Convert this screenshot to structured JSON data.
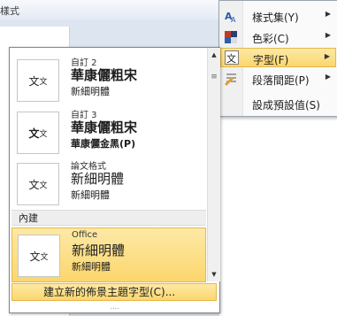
{
  "ribbon": {
    "partial_label": "樣式"
  },
  "menu": {
    "items": [
      {
        "label": "樣式集(Y)",
        "icon": "style-set-icon",
        "has_submenu": true
      },
      {
        "label": "色彩(C)",
        "icon": "color-palette-icon",
        "has_submenu": true
      },
      {
        "label": "字型(F)",
        "icon": "font-icon",
        "has_submenu": true,
        "highlighted": true
      },
      {
        "label": "段落間距(P)",
        "icon": "paragraph-spacing-icon",
        "has_submenu": true
      },
      {
        "label": "設成預設值(S)",
        "icon": "",
        "has_submenu": false
      }
    ],
    "submenu_arrow": "▶"
  },
  "gallery": {
    "items": [
      {
        "name": "自訂 2",
        "thumb_major": "文",
        "thumb_minor": "文",
        "major_font": "華康儷粗宋",
        "minor_font": "新細明體"
      },
      {
        "name": "自訂 3",
        "thumb_major": "文",
        "thumb_minor": "文",
        "major_font": "華康儷粗宋",
        "minor_font": "華康儷金黑(P)"
      },
      {
        "name": "論文格式",
        "thumb_major": "文",
        "thumb_minor": "文",
        "major_font": "新細明體",
        "minor_font": "新細明體"
      }
    ],
    "section_builtin": "內建",
    "builtin_items": [
      {
        "name": "Office",
        "thumb_major": "文",
        "thumb_minor": "文",
        "major_font": "新細明體",
        "minor_font": "新細明體",
        "selected": true
      }
    ],
    "create_label": "建立新的佈景主題字型(C)...",
    "resize_grip": "....",
    "scroll_up": "▲",
    "scroll_down": "▼",
    "scroll_grip": "≡"
  },
  "colors": {
    "highlight": "#fbd66d",
    "highlight_border": "#e5b84a",
    "background": "#dde5f0"
  }
}
